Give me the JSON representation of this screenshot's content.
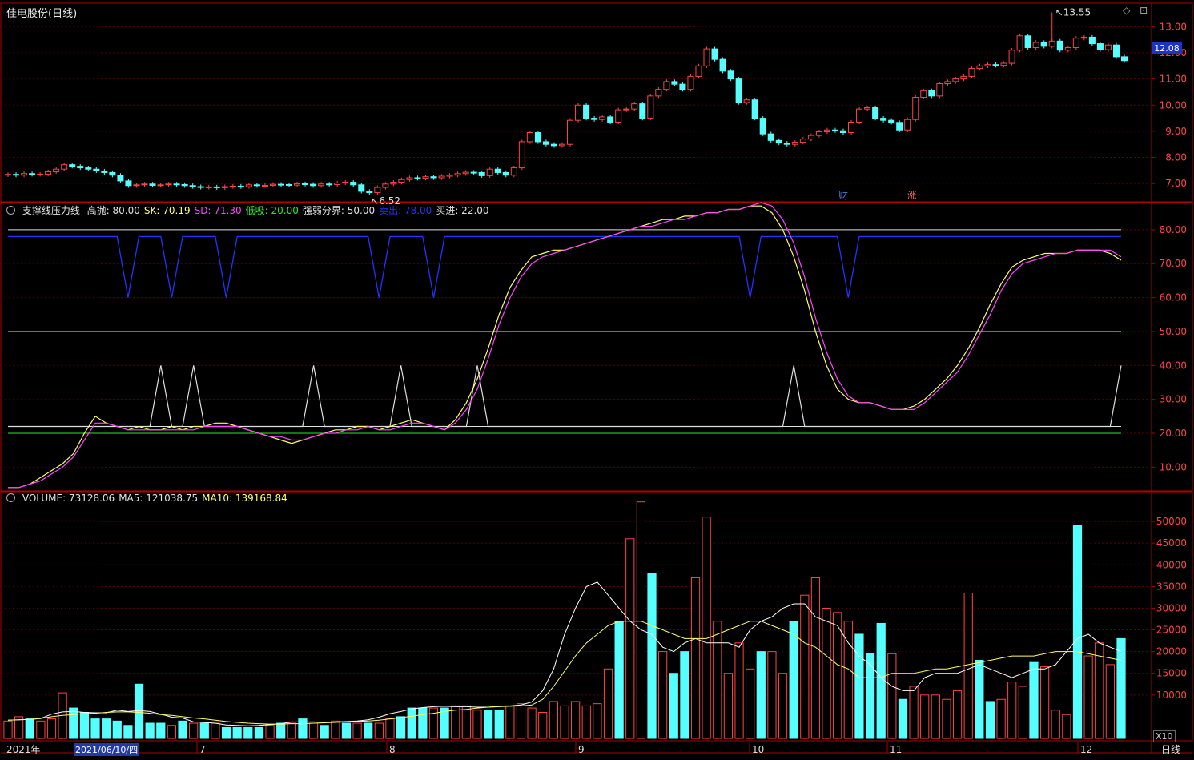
{
  "title": "佳电股份(日线)",
  "current_price": "12.08",
  "price_high_label": "13.55",
  "price_low_label": "6.52",
  "events": [
    {
      "label": "财",
      "color": "#4a7fd6"
    },
    {
      "label": "涨",
      "color": "#ff6a6a"
    }
  ],
  "indicator_legend": {
    "name": "支撑线压力线",
    "items": [
      {
        "label": "高抛: 80.00",
        "color": "#e0e0e0"
      },
      {
        "label": "SK: 70.19",
        "color": "#ffff66"
      },
      {
        "label": "SD: 71.30",
        "color": "#ff44ff"
      },
      {
        "label": "低吸: 20.00",
        "color": "#22ee22"
      },
      {
        "label": "强弱分界: 50.00",
        "color": "#e0e0e0"
      },
      {
        "label": "卖出: 78.00",
        "color": "#2233ff"
      },
      {
        "label": "买进: 22.00",
        "color": "#e0e0e0"
      }
    ]
  },
  "volume_legend": [
    {
      "label": "VOLUME: 73128.06",
      "color": "#e0e0e0"
    },
    {
      "label": "MA5: 121038.75",
      "color": "#e0e0e0"
    },
    {
      "label": "MA10: 139168.84",
      "color": "#ffff66"
    }
  ],
  "x_labels": {
    "year": "2021年",
    "date_box": "2021/06/10/四",
    "months": [
      "7",
      "8",
      "9",
      "10",
      "11",
      "12"
    ],
    "period": "日线"
  },
  "volume_multiplier": "X10",
  "colors": {
    "up": "#ff4444",
    "down": "#55ffff",
    "grid": "#5a0000",
    "axis": "#b00000"
  },
  "chart_data": [
    {
      "type": "candlestick",
      "title": "佳电股份(日线)",
      "ylim": [
        6.3,
        13.9
      ],
      "y_ticks": [
        7.0,
        8.0,
        9.0,
        10.0,
        11.0,
        12.0,
        13.0
      ],
      "close": [
        7.35,
        7.32,
        7.38,
        7.35,
        7.36,
        7.45,
        7.55,
        7.72,
        7.66,
        7.6,
        7.55,
        7.48,
        7.42,
        7.32,
        7.1,
        6.92,
        6.95,
        6.98,
        6.93,
        6.95,
        6.98,
        6.96,
        6.92,
        6.88,
        6.85,
        6.87,
        6.84,
        6.88,
        6.9,
        6.88,
        6.95,
        6.92,
        6.93,
        6.97,
        6.96,
        6.94,
        6.99,
        6.97,
        6.92,
        6.98,
        6.96,
        7.02,
        7.05,
        6.95,
        6.7,
        6.65,
        6.85,
        6.98,
        7.05,
        7.15,
        7.22,
        7.2,
        7.26,
        7.22,
        7.28,
        7.32,
        7.38,
        7.43,
        7.42,
        7.3,
        7.55,
        7.42,
        7.32,
        7.6,
        8.6,
        8.95,
        8.6,
        8.5,
        8.45,
        8.5,
        9.42,
        10.0,
        9.5,
        9.45,
        9.55,
        9.35,
        9.82,
        9.85,
        10.05,
        9.5,
        10.35,
        10.6,
        10.9,
        10.8,
        10.6,
        11.1,
        11.5,
        12.15,
        11.75,
        11.3,
        11.0,
        10.1,
        10.2,
        9.5,
        8.9,
        8.65,
        8.55,
        8.5,
        8.58,
        8.7,
        8.84,
        8.98,
        9.05,
        9.02,
        8.95,
        9.35,
        9.85,
        9.9,
        9.5,
        9.42,
        9.34,
        9.05,
        9.45,
        10.3,
        10.55,
        10.35,
        10.82,
        10.9,
        11.0,
        11.1,
        11.4,
        11.5,
        11.55,
        11.52,
        11.6,
        12.1,
        12.65,
        12.2,
        12.4,
        12.25,
        12.45,
        12.1,
        12.2,
        12.56,
        12.6,
        12.35,
        12.12,
        12.3,
        11.85,
        11.7
      ],
      "sample_bars": [
        {
          "idx": 45,
          "low": 6.52
        },
        {
          "idx": 106,
          "high": 12.85
        },
        {
          "idx": 130,
          "high": 13.55
        },
        {
          "idx": 141,
          "last": 12.08
        }
      ]
    },
    {
      "type": "line",
      "title": "支撑线压力线",
      "ylim": [
        3,
        88
      ],
      "y_ticks": [
        10,
        20,
        30,
        40,
        50,
        60,
        70,
        80
      ],
      "hlines": [
        {
          "name": "高抛",
          "value": 80,
          "color": "#e0e0e0"
        },
        {
          "name": "强弱分界",
          "value": 50,
          "color": "#e0e0e0"
        },
        {
          "name": "买进",
          "value": 22,
          "color": "#e0e0e0"
        },
        {
          "name": "低吸",
          "value": 20,
          "color": "#22ee22"
        }
      ],
      "series": [
        {
          "name": "SK",
          "color": "#ffff66",
          "values": [
            4,
            4,
            5,
            7,
            9,
            11,
            14,
            20,
            25,
            23,
            22,
            21,
            22,
            21,
            21,
            22,
            21,
            22,
            22,
            23,
            23,
            22,
            21,
            20,
            19,
            18,
            17,
            18,
            19,
            20,
            21,
            21,
            22,
            22,
            21,
            22,
            23,
            24,
            23,
            22,
            21,
            24,
            29,
            36,
            45,
            55,
            63,
            68,
            72,
            73,
            74,
            74,
            75,
            76,
            77,
            78,
            79,
            80,
            81,
            82,
            83,
            83,
            84,
            84,
            85,
            85,
            86,
            86,
            87,
            87,
            85,
            80,
            72,
            62,
            50,
            40,
            33,
            30,
            29,
            29,
            28,
            27,
            27,
            28,
            30,
            33,
            36,
            40,
            45,
            51,
            58,
            64,
            69,
            71,
            72,
            73,
            73,
            73,
            74,
            74,
            74,
            73,
            71
          ]
        },
        {
          "name": "SD",
          "color": "#ff44ff",
          "values": [
            4,
            4,
            5,
            6,
            8,
            10,
            13,
            18,
            23,
            23,
            22,
            21,
            21,
            21,
            21,
            21,
            21,
            21,
            22,
            22,
            22,
            22,
            21,
            20,
            19,
            19,
            18,
            18,
            19,
            20,
            20,
            21,
            21,
            22,
            21,
            21,
            22,
            23,
            23,
            22,
            21,
            23,
            27,
            33,
            42,
            52,
            60,
            66,
            70,
            72,
            73,
            74,
            75,
            76,
            77,
            78,
            79,
            80,
            81,
            81,
            82,
            83,
            83,
            84,
            85,
            85,
            86,
            86,
            87,
            88,
            87,
            83,
            76,
            66,
            54,
            44,
            36,
            31,
            29,
            29,
            28,
            27,
            27,
            27,
            29,
            32,
            35,
            38,
            43,
            49,
            55,
            62,
            67,
            70,
            71,
            72,
            73,
            73,
            74,
            74,
            74,
            74,
            72
          ]
        }
      ],
      "signals": {
        "sell_line": {
          "name": "卖出",
          "value": 78,
          "dip_value": 60,
          "dip_index": [
            11,
            15,
            20,
            34,
            39,
            68,
            77,
            124
          ],
          "color": "#2233ff"
        },
        "buy_line": {
          "name": "买进",
          "value": 22,
          "spike_value": 40,
          "spike_index": [
            14,
            17,
            28,
            36,
            43,
            72,
            102
          ],
          "color": "#e0e0e0"
        }
      }
    },
    {
      "type": "bar",
      "title": "VOLUME",
      "ylim": [
        0,
        55000
      ],
      "y_ticks": [
        10000,
        15000,
        20000,
        25000,
        30000,
        35000,
        40000,
        45000,
        50000
      ],
      "values": [
        4000,
        5000,
        4500,
        4000,
        4500,
        10500,
        7000,
        6000,
        4500,
        4500,
        4000,
        3000,
        12500,
        3500,
        3500,
        3000,
        4000,
        3500,
        3500,
        3500,
        2500,
        2500,
        2500,
        2500,
        3000,
        3500,
        3500,
        4500,
        3500,
        3000,
        4000,
        3500,
        3500,
        3500,
        3500,
        4500,
        5000,
        7000,
        7000,
        7000,
        7000,
        7500,
        7500,
        6500,
        6500,
        6500,
        7500,
        8000,
        7000,
        6000,
        8500,
        7500,
        8500,
        7500,
        8000,
        16000,
        27000,
        46000,
        54500,
        38000,
        20000,
        15000,
        20000,
        37000,
        51000,
        27000,
        15000,
        22000,
        16000,
        20000,
        20000,
        15000,
        27000,
        33000,
        37000,
        30000,
        29000,
        27000,
        24000,
        19500,
        26500,
        19500,
        9000,
        12000,
        10000,
        10000,
        9000,
        11000,
        33500,
        18000,
        8500,
        9000,
        13000,
        12000,
        17500,
        16500,
        6500,
        5500,
        49000,
        19000,
        22000,
        17000,
        23000
      ],
      "up": [
        1,
        1,
        0,
        1,
        1,
        1,
        0,
        0,
        0,
        0,
        0,
        0,
        0,
        0,
        0,
        1,
        0,
        1,
        0,
        1,
        0,
        0,
        0,
        0,
        1,
        0,
        1,
        0,
        1,
        0,
        1,
        0,
        1,
        0,
        1,
        1,
        0,
        0,
        0,
        1,
        0,
        1,
        1,
        1,
        0,
        0,
        1,
        1,
        1,
        1,
        1,
        1,
        1,
        1,
        1,
        1,
        0,
        1,
        1,
        0,
        1,
        0,
        0,
        1,
        1,
        1,
        1,
        1,
        1,
        0,
        1,
        1,
        0,
        1,
        1,
        1,
        1,
        1,
        0,
        0,
        0,
        1,
        0,
        1,
        1,
        1,
        1,
        1,
        1,
        0,
        0,
        1,
        1,
        1,
        0,
        1,
        1,
        1,
        0,
        1,
        1,
        1,
        0
      ],
      "series": [
        {
          "name": "MA5",
          "color": "#ffffff",
          "values": [
            4200,
            4300,
            4400,
            4600,
            5600,
            6100,
            6200,
            6000,
            5900,
            5900,
            6500,
            6200,
            6400,
            6200,
            5600,
            4900,
            4700,
            3800,
            3700,
            3500,
            3100,
            3000,
            2900,
            3000,
            3200,
            3400,
            3800,
            3800,
            3800,
            3700,
            3800,
            3900,
            4000,
            4300,
            4900,
            5700,
            6200,
            6800,
            7100,
            7300,
            7400,
            7300,
            7300,
            7200,
            7200,
            7400,
            7500,
            7700,
            8400,
            11000,
            16000,
            24000,
            30000,
            35000,
            36000,
            33000,
            30000,
            27000,
            25000,
            24000,
            21000,
            20000,
            22000,
            23000,
            22000,
            22000,
            22000,
            21000,
            25000,
            27000,
            28000,
            30000,
            31000,
            31000,
            28000,
            27000,
            26000,
            22000,
            19000,
            17000,
            14000,
            12000,
            11000,
            11000,
            14000,
            15000,
            15000,
            15000,
            16000,
            17000,
            16000,
            15000,
            14000,
            15000,
            16000,
            16000,
            17000,
            20000,
            23000,
            24000,
            22000,
            21000,
            20000
          ]
        },
        {
          "name": "MA10",
          "color": "#ffff66",
          "values": [
            4200,
            4300,
            4400,
            4600,
            5000,
            5300,
            5500,
            5700,
            5800,
            6000,
            6100,
            6100,
            6000,
            5800,
            5500,
            5300,
            5000,
            4700,
            4500,
            4200,
            3900,
            3700,
            3500,
            3400,
            3300,
            3300,
            3400,
            3400,
            3500,
            3600,
            3700,
            3800,
            3900,
            4000,
            4200,
            4500,
            4800,
            5100,
            5500,
            5800,
            6200,
            6500,
            6700,
            7000,
            7200,
            7300,
            7400,
            7500,
            7700,
            9000,
            12000,
            15500,
            19000,
            22000,
            24000,
            26000,
            27000,
            27000,
            27000,
            26000,
            25000,
            24000,
            23000,
            23000,
            23000,
            24000,
            25000,
            26000,
            27000,
            27000,
            26000,
            25000,
            24000,
            22000,
            21000,
            19000,
            17000,
            16000,
            14000,
            14000,
            14000,
            15000,
            15000,
            15000,
            15500,
            16000,
            16000,
            16500,
            17000,
            17500,
            18000,
            18500,
            19000,
            19000,
            19000,
            19500,
            20000,
            20000,
            20000,
            19500,
            19000,
            18500,
            18000
          ]
        }
      ]
    }
  ]
}
